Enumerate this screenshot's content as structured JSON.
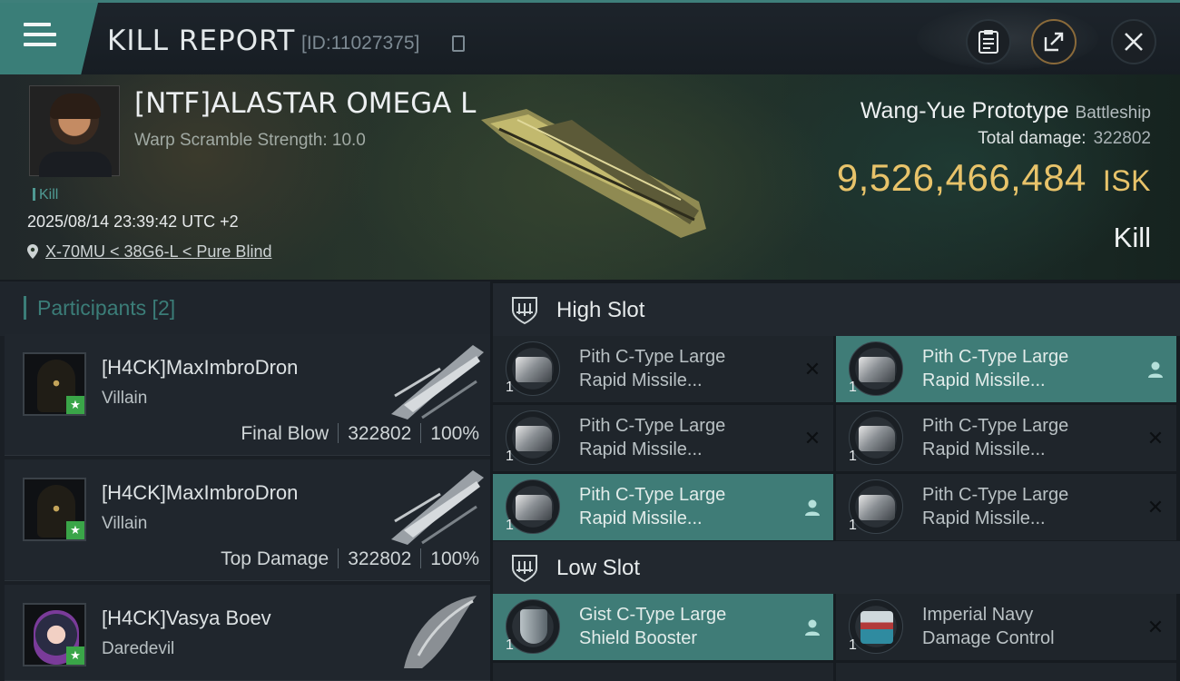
{
  "header": {
    "title": "KILL REPORT",
    "report_id": "[ID:11027375]"
  },
  "victim": {
    "name": "[NTF]ALASTAR OMEGA L",
    "warp_scramble": "Warp Scramble Strength: 10.0",
    "tag": "Kill",
    "datetime": "2025/08/14 23:39:42 UTC +2",
    "location": "X-70MU < 38G6-L < Pure Blind",
    "ship_name": "Wang-Yue Prototype",
    "ship_class": "Battleship",
    "total_damage_label": "Total damage:",
    "total_damage": "322802",
    "isk_value": "9,526,466,484",
    "isk_unit": "ISK",
    "result": "Kill"
  },
  "participants": {
    "title": "Participants [2]",
    "rows": [
      {
        "name": "[H4CK]MaxImbroDron",
        "ship": "Villain",
        "role": "Final Blow",
        "damage": "322802",
        "percent": "100%"
      },
      {
        "name": "[H4CK]MaxImbroDron",
        "ship": "Villain",
        "role": "Top Damage",
        "damage": "322802",
        "percent": "100%"
      },
      {
        "name": "[H4CK]Vasya Boev",
        "ship": "Daredevil"
      }
    ]
  },
  "fitting": {
    "high_slot_title": "High Slot",
    "low_slot_title": "Low Slot",
    "high_slot": [
      {
        "qty": "1",
        "line1": "Pith C-Type Large",
        "line2": "Rapid Missile...",
        "state": "destroyed"
      },
      {
        "qty": "1",
        "line1": "Pith C-Type Large",
        "line2": "Rapid Missile...",
        "state": "dropped"
      },
      {
        "qty": "1",
        "line1": "Pith C-Type Large",
        "line2": "Rapid Missile...",
        "state": "destroyed"
      },
      {
        "qty": "1",
        "line1": "Pith C-Type Large",
        "line2": "Rapid Missile...",
        "state": "destroyed"
      },
      {
        "qty": "1",
        "line1": "Pith C-Type Large",
        "line2": "Rapid Missile...",
        "state": "dropped"
      },
      {
        "qty": "1",
        "line1": "Pith C-Type Large",
        "line2": "Rapid Missile...",
        "state": "destroyed"
      }
    ],
    "low_slot": [
      {
        "qty": "1",
        "line1": "Gist C-Type Large",
        "line2": "Shield Booster",
        "state": "dropped"
      },
      {
        "qty": "1",
        "line1": "Imperial Navy",
        "line2": "Damage Control",
        "state": "destroyed"
      }
    ]
  },
  "icons": {
    "destroyed": "close-x-icon",
    "dropped": "person-icon"
  },
  "colors": {
    "accent": "#3f7c77",
    "isk": "#e8c36a",
    "rank_star": "#3aa548"
  }
}
